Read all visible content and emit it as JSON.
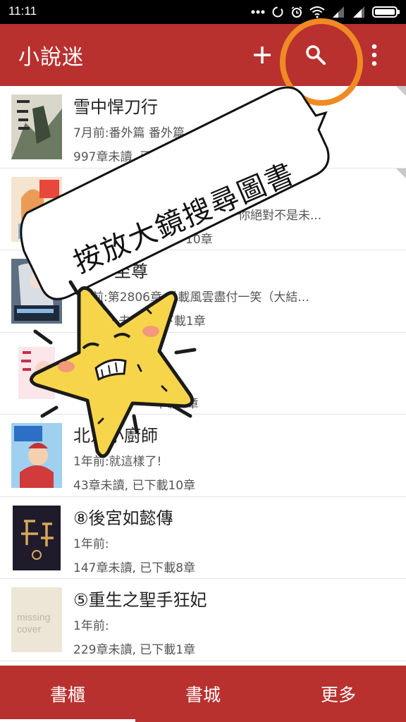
{
  "status_bar": {
    "time": "11:11",
    "icons": [
      "more-dots-icon",
      "sync-icon",
      "alarm-icon",
      "wifi-icon",
      "signal-icon",
      "signal-icon",
      "battery-icon"
    ]
  },
  "app_bar": {
    "title": "小說迷",
    "actions": [
      "add-icon",
      "search-icon",
      "more-vert-icon"
    ],
    "color": "#b8312f"
  },
  "books": [
    {
      "title": "雪中悍刀行",
      "update": "7月前:番外篇 番外篇",
      "progress": "997章未讀, 已",
      "cover": "cover-xuezhong"
    },
    {
      "title": "",
      "update": "你絕對不是未...",
      "progress": "10章",
      "cover": "cover-anime-girl"
    },
    {
      "title": "至尊",
      "update": "前:第2806章 千載風雲盡付一笑（大結...",
      "progress": "未讀, 已下載1章",
      "cover": "cover-wangu"
    },
    {
      "title": "",
      "update": "",
      "progress": "下載1章",
      "cover": "cover-mingmen"
    },
    {
      "title": "北京小廚師",
      "update": "1年前:就這樣了!",
      "progress": "43章未讀, 已下載10章",
      "cover": "cover-chef"
    },
    {
      "title": "⑧後宮如懿傳",
      "update": "1年前:",
      "progress": "147章未讀, 已下載8章",
      "cover": "cover-houggong"
    },
    {
      "title": "⑤重生之聖手狂妃",
      "update": "1年前:",
      "progress": "229章未讀, 已下載1章",
      "cover": "cover-missing"
    }
  ],
  "missing_cover_text": "missing cover",
  "bottom_nav": {
    "tabs": [
      "書櫃",
      "書城",
      "更多"
    ],
    "active": "書櫃"
  },
  "tutorial": {
    "bubble_text": "按放大鏡搜尋圖書",
    "highlight_color": "#f08a24"
  }
}
